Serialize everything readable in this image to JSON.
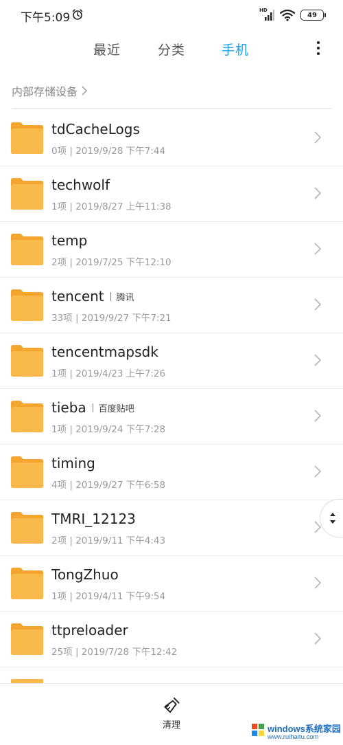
{
  "status_bar": {
    "time": "下午5:09",
    "network": "HD",
    "battery": "49"
  },
  "tabs": [
    {
      "label": "最近",
      "active": false
    },
    {
      "label": "分类",
      "active": false
    },
    {
      "label": "手机",
      "active": true
    }
  ],
  "breadcrumb": {
    "label": "内部存储设备"
  },
  "files": [
    {
      "name": "tdCacheLogs",
      "alias": "",
      "meta": "0项 | 2019/9/28 下午7:44"
    },
    {
      "name": "techwolf",
      "alias": "",
      "meta": "1项 | 2019/8/27 上午11:38"
    },
    {
      "name": "temp",
      "alias": "",
      "meta": "2项 | 2019/7/25 下午12:10"
    },
    {
      "name": "tencent",
      "alias": "腾讯",
      "meta": "33项 | 2019/9/27 下午7:21"
    },
    {
      "name": "tencentmapsdk",
      "alias": "",
      "meta": "1项 | 2019/4/23 上午7:26"
    },
    {
      "name": "tieba",
      "alias": "百度贴吧",
      "meta": "1项 | 2019/9/24 下午7:28"
    },
    {
      "name": "timing",
      "alias": "",
      "meta": "4项 | 2019/9/27 下午6:58"
    },
    {
      "name": "TMRI_12123",
      "alias": "",
      "meta": "2项 | 2019/9/11 下午4:43"
    },
    {
      "name": "TongZhuo",
      "alias": "",
      "meta": "1项 | 2019/4/11 下午9:54"
    },
    {
      "name": "ttpreloader",
      "alias": "",
      "meta": "25项 | 2019/7/28 下午12:42"
    }
  ],
  "bottom_bar": {
    "clean_label": "清理"
  },
  "watermark": {
    "text": "windows系统家园",
    "url": "www.ruihaitu.com"
  },
  "colors": {
    "accent": "#1aa1f0",
    "folder": "#f9b84a",
    "folder_tab": "#f3a52f"
  },
  "icons": {
    "alarm": "alarm-clock-icon",
    "signal": "cell-signal-icon",
    "wifi": "wifi-icon",
    "battery": "battery-icon",
    "more": "more-vertical-icon",
    "chevron": "chevron-right-icon",
    "folder": "folder-icon",
    "clean": "broom-icon",
    "scroll": "fast-scroll-icon"
  }
}
